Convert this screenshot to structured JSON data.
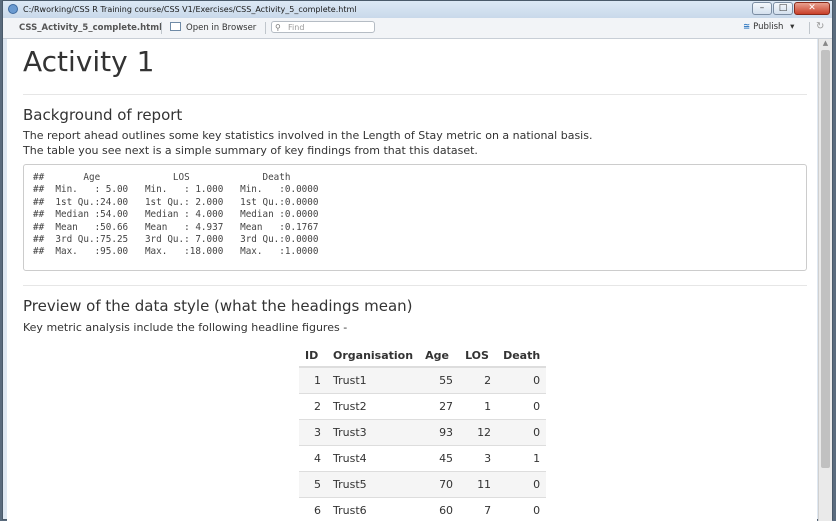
{
  "window": {
    "title": "C:/Rworking/CSS R Training course/CSS V1/Exercises/CSS_Activity_5_complete.html",
    "controls": {
      "minimize": "–",
      "maximize": "□",
      "close": "✕"
    }
  },
  "toolbar": {
    "filename": "CSS_Activity_5_complete.html",
    "open_in_browser": "Open in Browser",
    "find_placeholder": "Find",
    "publish": "Publish",
    "publish_caret": "▾",
    "refresh_glyph": "↻"
  },
  "page": {
    "title": "Activity 1",
    "section1": {
      "heading": "Background of report",
      "lines": [
        "The report ahead outlines some key statistics involved in the Length of Stay metric on a national basis.",
        "The table you see next is a simple summary of key findings from that this dataset."
      ],
      "code": "##       Age             LOS             Death       \n##  Min.   : 5.00   Min.   : 1.000   Min.   :0.0000  \n##  1st Qu.:24.00   1st Qu.: 2.000   1st Qu.:0.0000  \n##  Median :54.00   Median : 4.000   Median :0.0000  \n##  Mean   :50.66   Mean   : 4.937   Mean   :0.1767  \n##  3rd Qu.:75.25   3rd Qu.: 7.000   3rd Qu.:0.0000  \n##  Max.   :95.00   Max.   :18.000   Max.   :1.0000  "
    },
    "section2": {
      "heading": "Preview of the data style (what the headings mean)",
      "intro": "Key metric analysis include the following headline figures -"
    },
    "table": {
      "headers": [
        "ID",
        "Organisation",
        "Age",
        "LOS",
        "Death"
      ],
      "rows": [
        [
          "1",
          "Trust1",
          "55",
          "2",
          "0"
        ],
        [
          "2",
          "Trust2",
          "27",
          "1",
          "0"
        ],
        [
          "3",
          "Trust3",
          "93",
          "12",
          "0"
        ],
        [
          "4",
          "Trust4",
          "45",
          "3",
          "1"
        ],
        [
          "5",
          "Trust5",
          "70",
          "11",
          "0"
        ],
        [
          "6",
          "Trust6",
          "60",
          "7",
          "0"
        ]
      ]
    }
  }
}
